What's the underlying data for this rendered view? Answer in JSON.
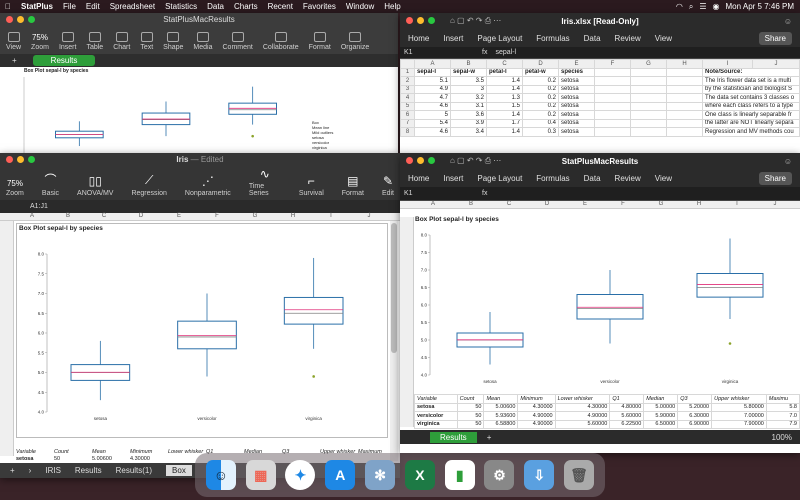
{
  "menubar": {
    "items": [
      "StatPlus",
      "File",
      "Edit",
      "Spreadsheet",
      "Statistics",
      "Data",
      "Charts",
      "Recent",
      "Favorites",
      "Window",
      "Help"
    ],
    "datetime": "Mon Apr 5  7:46 PM"
  },
  "win_top_left": {
    "title": "StatPlusMacResults",
    "zoom": "75%",
    "toolbar": [
      "View",
      "Zoom",
      "Insert",
      "Table",
      "Chart",
      "Text",
      "Shape",
      "Media",
      "Comment",
      "Collaborate",
      "Format",
      "Organize"
    ],
    "tab": "Results",
    "chart_title": "Box Plot sepal-l by species",
    "legend": [
      "Box",
      "Mean line",
      "Mild outliers",
      "setosa",
      "versicolor",
      "virginica"
    ]
  },
  "win_iris_edited": {
    "title": "Iris",
    "subtitle": "— Edited",
    "zoom": "75%",
    "zoom_label": "Zoom",
    "tools": [
      "Basic",
      "ANOVA/MV",
      "Regression",
      "Nonparametric",
      "Time Series",
      "Survival",
      "Format",
      "Edit"
    ],
    "cell_ref": "A1:J1",
    "columns": [
      "A",
      "B",
      "C",
      "D",
      "E",
      "F",
      "G",
      "H",
      "I",
      "J"
    ],
    "chart_title": "Box Plot sepal-l by species",
    "table_headers": [
      "Variable",
      "Count",
      "Mean",
      "Minimum",
      "Lower whisker",
      "Q1",
      "Median",
      "Q3",
      "Upper whisker",
      "Maximum"
    ],
    "row_setosa": [
      "setosa",
      "50",
      "5.00600",
      "4.30000"
    ],
    "sheet_tabs": [
      "IRIS",
      "Results",
      "Results(1)",
      "Box"
    ]
  },
  "win_iris_xlsx": {
    "title": "Iris.xlsx  [Read-Only]",
    "ribbon": [
      "Home",
      "Insert",
      "Page Layout",
      "Formulas",
      "Data",
      "Review",
      "View"
    ],
    "share": "Share",
    "cell_ref": "K1",
    "formula": "sepal-l",
    "columns": [
      "A",
      "B",
      "C",
      "D",
      "E",
      "F",
      "G",
      "H",
      "I",
      "J"
    ],
    "headers": [
      "sepal-l",
      "sepal-w",
      "petal-l",
      "petal-w",
      "species"
    ],
    "rows": [
      [
        "5.1",
        "3.5",
        "1.4",
        "0.2",
        "setosa"
      ],
      [
        "4.9",
        "3",
        "1.4",
        "0.2",
        "setosa"
      ],
      [
        "4.7",
        "3.2",
        "1.3",
        "0.2",
        "setosa"
      ],
      [
        "4.6",
        "3.1",
        "1.5",
        "0.2",
        "setosa"
      ],
      [
        "5",
        "3.6",
        "1.4",
        "0.2",
        "setosa"
      ],
      [
        "5.4",
        "3.9",
        "1.7",
        "0.4",
        "setosa"
      ],
      [
        "4.6",
        "3.4",
        "1.4",
        "0.3",
        "setosa"
      ]
    ],
    "note_title": "Note/Source:",
    "notes": [
      "The Iris flower data set is a multi",
      "by the statistician and biologist S",
      "The data set contains 3 classes o",
      "where each class refers to a type",
      "One class is linearly separable fr",
      "the latter are NOT linearly separa",
      "Regression and MV methods cou"
    ]
  },
  "win_results": {
    "title": "StatPlusMacResults",
    "ribbon": [
      "Home",
      "Insert",
      "Page Layout",
      "Formulas",
      "Data",
      "Review",
      "View"
    ],
    "share": "Share",
    "cell_ref": "K1",
    "columns": [
      "A",
      "B",
      "C",
      "D",
      "E",
      "F",
      "G",
      "H",
      "I",
      "J"
    ],
    "chart_title": "Box Plot sepal-l by species",
    "table_headers": [
      "Variable",
      "Count",
      "Mean",
      "Minimum",
      "Lower whisker",
      "Q1",
      "Median",
      "Q3",
      "Upper whisker",
      "Maximu"
    ],
    "table_rows": [
      [
        "setosa",
        "50",
        "5.00600",
        "4.30000",
        "4.30000",
        "4.80000",
        "5.00000",
        "5.20000",
        "5.80000",
        "5.8"
      ],
      [
        "versicolor",
        "50",
        "5.93600",
        "4.90000",
        "4.90000",
        "5.60000",
        "5.90000",
        "6.30000",
        "7.00000",
        "7.0"
      ],
      [
        "virginica",
        "50",
        "6.58800",
        "4.90000",
        "5.60000",
        "6.22500",
        "6.50000",
        "6.90000",
        "7.90000",
        "7.9"
      ]
    ],
    "tab": "Results",
    "zoom": "100%"
  },
  "chart_data": {
    "type": "box",
    "title": "Box Plot sepal-l by species",
    "categories": [
      "setosa",
      "versicolor",
      "virginica"
    ],
    "ylim": [
      4,
      8
    ],
    "yticks": [
      "4.0",
      "4.5",
      "5.0",
      "5.5",
      "6.0",
      "6.5",
      "7.0",
      "7.5",
      "8.0"
    ],
    "boxes": [
      {
        "name": "setosa",
        "lower_whisker": 4.3,
        "q1": 4.8,
        "median": 5.0,
        "mean": 5.006,
        "q3": 5.2,
        "upper_whisker": 5.8,
        "outliers": []
      },
      {
        "name": "versicolor",
        "lower_whisker": 4.9,
        "q1": 5.6,
        "median": 5.9,
        "mean": 5.936,
        "q3": 6.3,
        "upper_whisker": 7.0,
        "outliers": []
      },
      {
        "name": "virginica",
        "lower_whisker": 5.6,
        "q1": 6.225,
        "median": 6.5,
        "mean": 6.588,
        "q3": 6.9,
        "upper_whisker": 7.9,
        "outliers": [
          4.9
        ]
      }
    ],
    "colors": {
      "box": "#2a6fa8",
      "median": "#7f7f7f",
      "mean": "#e0317a",
      "outlier": "#8ba32a"
    }
  },
  "dock": {
    "apps": [
      "finder-icon",
      "launchpad-icon",
      "safari-icon",
      "app-store-icon",
      "statplus-icon",
      "excel-icon",
      "numbers-icon",
      "system-prefs-icon",
      "downloads-icon",
      "trash-icon"
    ]
  }
}
